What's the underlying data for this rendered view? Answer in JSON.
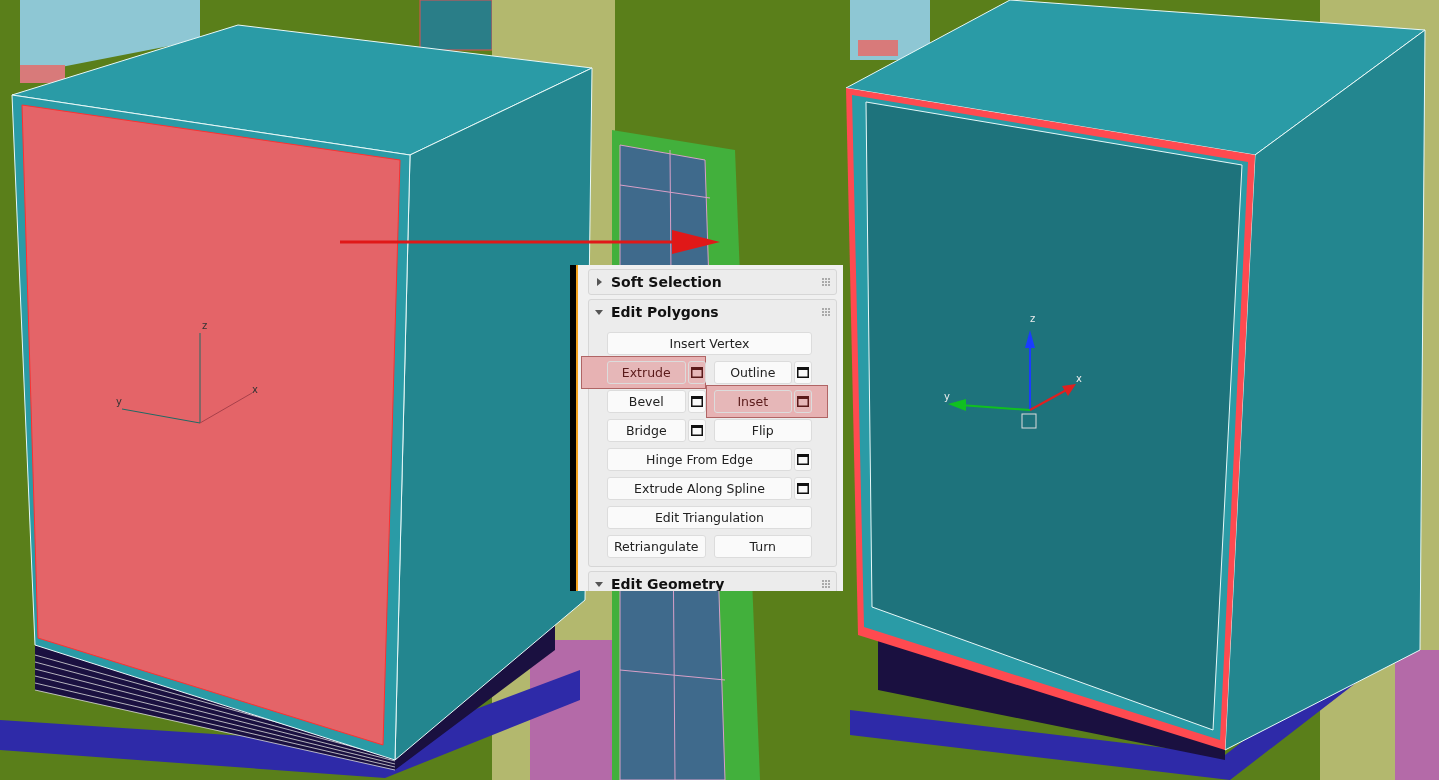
{
  "left_gizmo": {
    "labels": [
      "z",
      "y",
      "x"
    ]
  },
  "right_gizmo": {
    "labels": [
      "z",
      "y",
      "x"
    ]
  },
  "panel": {
    "rollouts": [
      {
        "title": "Soft Selection",
        "expanded": false
      },
      {
        "title": "Edit Polygons",
        "expanded": true,
        "rows": [
          [
            {
              "label": "Insert Vertex",
              "kind": "wide",
              "settings": false,
              "highlighted": false
            }
          ],
          [
            {
              "label": "Extrude",
              "kind": "half",
              "settings": true,
              "highlighted": true
            },
            {
              "label": "Outline",
              "kind": "half",
              "settings": true,
              "highlighted": false
            }
          ],
          [
            {
              "label": "Bevel",
              "kind": "half",
              "settings": true,
              "highlighted": false
            },
            {
              "label": "Inset",
              "kind": "half",
              "settings": true,
              "highlighted": true
            }
          ],
          [
            {
              "label": "Bridge",
              "kind": "half",
              "settings": true,
              "highlighted": false
            },
            {
              "label": "Flip",
              "kind": "half",
              "settings": false,
              "highlighted": false
            }
          ],
          [
            {
              "label": "Hinge From Edge",
              "kind": "wide",
              "settings": true,
              "highlighted": false
            }
          ],
          [
            {
              "label": "Extrude Along Spline",
              "kind": "wide",
              "settings": true,
              "highlighted": false
            }
          ],
          [
            {
              "label": "Edit Triangulation",
              "kind": "wide",
              "settings": false,
              "highlighted": false
            }
          ],
          [
            {
              "label": "Retriangulate",
              "kind": "half",
              "settings": false,
              "highlighted": false
            },
            {
              "label": "Turn",
              "kind": "half",
              "settings": false,
              "highlighted": false
            }
          ]
        ]
      },
      {
        "title": "Edit Geometry",
        "expanded": true
      }
    ]
  }
}
